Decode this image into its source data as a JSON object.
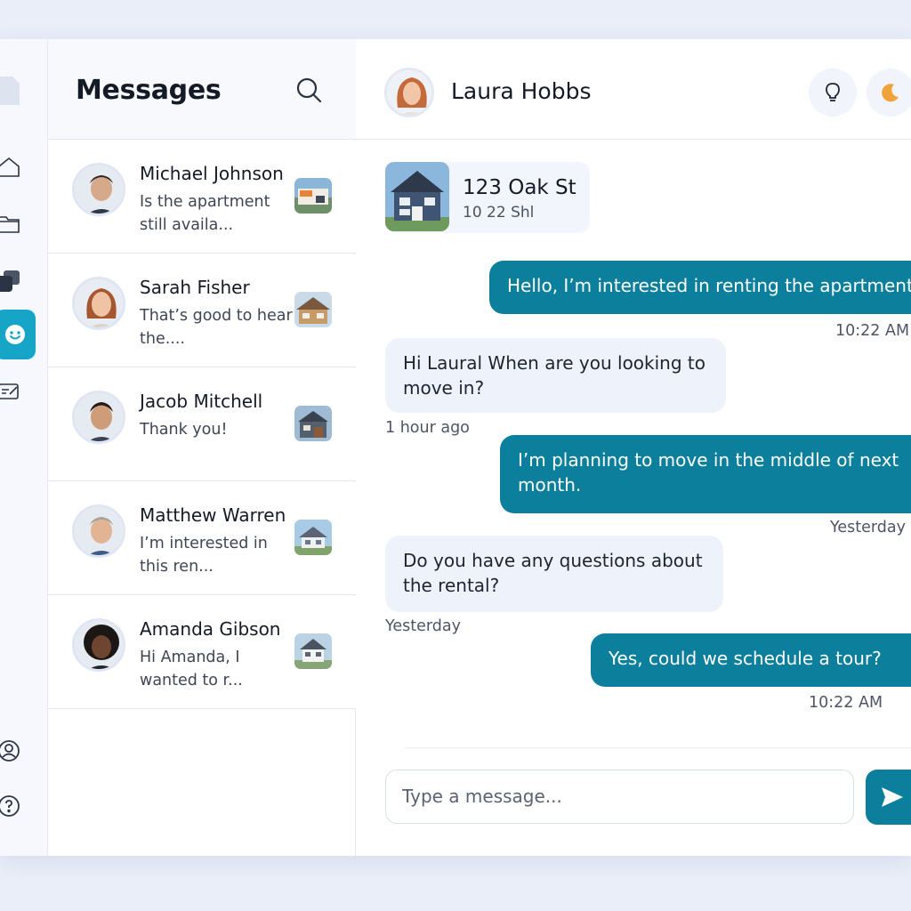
{
  "list": {
    "title": "Messages",
    "conversations": [
      {
        "name": "Michael Johnson",
        "preview": "Is the apartment still availa..."
      },
      {
        "name": "Sarah Fisher",
        "preview": "That’s good to hear the...."
      },
      {
        "name": "Jacob Mitchell",
        "preview": "Thank you!"
      },
      {
        "name": "Matthew Warren",
        "preview": "I’m interested in this ren..."
      },
      {
        "name": "Amanda Gibson",
        "preview": "Hi Amanda, I wanted to r..."
      }
    ]
  },
  "chat": {
    "contact_name": "Laura Hobbs",
    "listing": {
      "title": "123 Oak St",
      "subtitle": "10 22 Shl"
    },
    "messages": [
      {
        "direction": "out",
        "text": "Hello, I’m interested in renting the apartment.",
        "time": "10:22 AM"
      },
      {
        "direction": "in",
        "text": "Hi Laural When are you looking to move in?",
        "time": "1 hour ago"
      },
      {
        "direction": "out",
        "text": "I’m planning to move in the middle of next month.",
        "time": "Yesterday"
      },
      {
        "direction": "in",
        "text": "Do you have any questions about the rental?",
        "time": "Yesterday"
      },
      {
        "direction": "out",
        "text": "Yes, could we schedule a tour?",
        "time": "10:22 AM"
      }
    ],
    "composer": {
      "placeholder": "Type a message..."
    }
  },
  "icons": {
    "rail": [
      "document-icon",
      "home-icon",
      "folder-icon",
      "gallery-icon",
      "smiley-icon",
      "checklist-icon",
      "account-icon",
      "help-icon"
    ],
    "header": [
      "search-icon",
      "lightbulb-icon",
      "moon-icon",
      "send-icon"
    ]
  },
  "colors": {
    "accent": "#0b7f9b",
    "rail_active": "#16a5c7",
    "incoming_bubble": "#eef2fa",
    "background": "#e9eef9"
  }
}
